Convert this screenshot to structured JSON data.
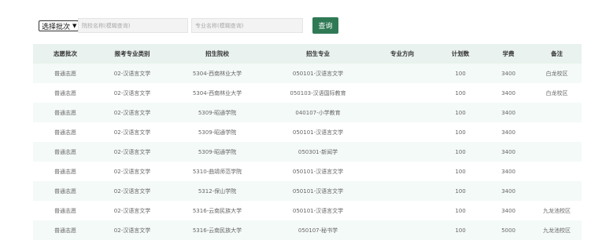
{
  "filters": {
    "batch_select": "选择批次",
    "school_placeholder": "院校名称(模糊查询)",
    "major_placeholder": "专业名称(模糊查询)",
    "query_label": "查询"
  },
  "table": {
    "headers": [
      "志愿批次",
      "报考专业类别",
      "招生院校",
      "招生专业",
      "专业方向",
      "计划数",
      "学费",
      "备注"
    ],
    "rows": [
      [
        "普通志愿",
        "02-汉语言文学",
        "5304-西南林业大学",
        "050101-汉语言文学",
        "",
        "100",
        "3400",
        "白龙校区"
      ],
      [
        "普通志愿",
        "02-汉语言文学",
        "5304-西南林业大学",
        "050103-汉语国际教育",
        "",
        "100",
        "3400",
        "白龙校区"
      ],
      [
        "普通志愿",
        "02-汉语言文学",
        "5309-昭通学院",
        "040107-小学教育",
        "",
        "100",
        "3400",
        ""
      ],
      [
        "普通志愿",
        "02-汉语言文学",
        "5309-昭通学院",
        "050101-汉语言文学",
        "",
        "100",
        "3400",
        ""
      ],
      [
        "普通志愿",
        "02-汉语言文学",
        "5309-昭通学院",
        "050301-新闻学",
        "",
        "100",
        "3400",
        ""
      ],
      [
        "普通志愿",
        "02-汉语言文学",
        "5310-曲靖师范学院",
        "050101-汉语言文学",
        "",
        "100",
        "3400",
        ""
      ],
      [
        "普通志愿",
        "02-汉语言文学",
        "5312-保山学院",
        "050101-汉语言文学",
        "",
        "100",
        "3400",
        ""
      ],
      [
        "普通志愿",
        "02-汉语言文学",
        "5316-云南民族大学",
        "050101-汉语言文学",
        "",
        "100",
        "3400",
        "九龙池校区"
      ],
      [
        "普通志愿",
        "02-汉语言文学",
        "5316-云南民族大学",
        "050107-秘书学",
        "",
        "100",
        "5000",
        "九龙池校区"
      ]
    ]
  }
}
